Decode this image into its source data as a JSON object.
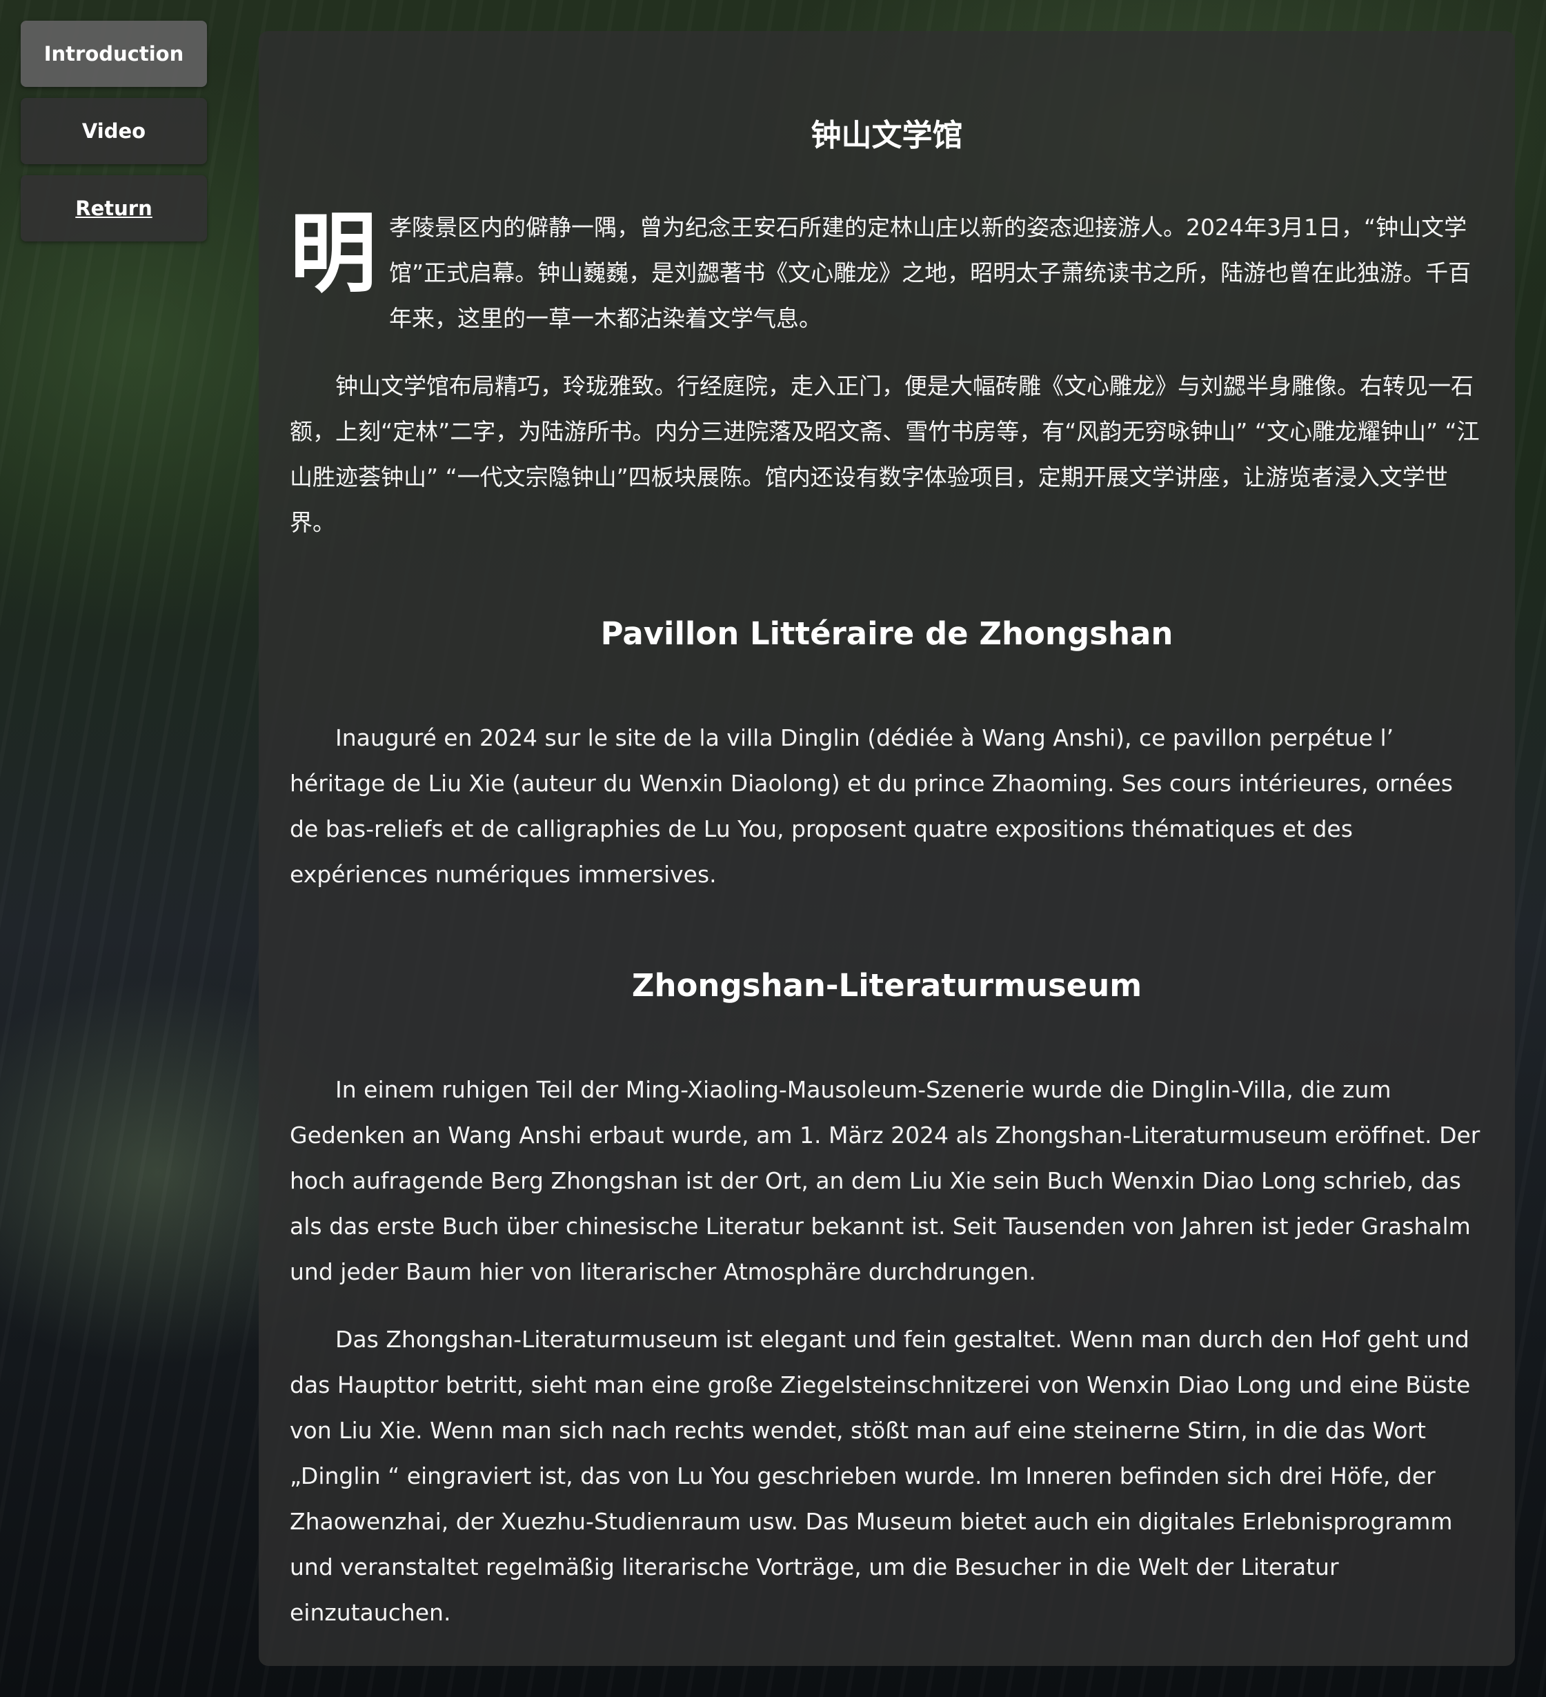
{
  "sidebar": {
    "items": [
      {
        "label": "Introduction",
        "active": true
      },
      {
        "label": "Video",
        "active": false
      },
      {
        "label": "Return",
        "active": false,
        "underlined": true
      }
    ]
  },
  "content": {
    "zh": {
      "title": "钟山文学馆",
      "dropcap": "明",
      "p1": "孝陵景区内的僻静一隅，曾为纪念王安石所建的定林山庄以新的姿态迎接游人。2024年3月1日，“钟山文学馆”正式启幕。钟山巍巍，是刘勰著书《文心雕龙》之地，昭明太子萧统读书之所，陆游也曾在此独游。千百年来，这里的一草一木都沾染着文学气息。",
      "p2": "钟山文学馆布局精巧，玲珑雅致。行经庭院，走入正门，便是大幅砖雕《文心雕龙》与刘勰半身雕像。右转见一石额，上刻“定林”二字，为陆游所书。内分三进院落及昭文斋、雪竹书房等，有“风韵无穷咏钟山” “文心雕龙耀钟山” “江山胜迹荟钟山” “一代文宗隐钟山”四板块展陈。馆内还设有数字体验项目，定期开展文学讲座，让游览者浸入文学世界。"
    },
    "fr": {
      "title": "Pavillon Littéraire de Zhongshan",
      "p1": "Inauguré en 2024 sur le site de la villa Dinglin (dédiée à Wang Anshi), ce pavillon perpétue l’ héritage de Liu Xie (auteur du Wenxin Diaolong) et du prince Zhaoming. Ses cours intérieures, ornées de bas-reliefs et de calligraphies de Lu You, proposent quatre expositions thématiques et des expériences numériques immersives."
    },
    "de": {
      "title": "Zhongshan-Literaturmuseum",
      "p1": "In einem ruhigen Teil der Ming-Xiaoling-Mausoleum-Szenerie wurde die Dinglin-Villa, die zum Gedenken an Wang Anshi erbaut wurde, am 1. März 2024 als Zhongshan-Literaturmuseum eröffnet. Der hoch aufragende Berg Zhongshan ist der Ort, an dem Liu Xie sein Buch Wenxin Diao Long schrieb, das als das erste Buch über chinesische Literatur bekannt ist. Seit Tausenden von Jahren ist jeder Grashalm und jeder Baum hier von literarischer Atmosphäre durchdrungen.",
      "p2": "Das Zhongshan-Literaturmuseum ist elegant und fein gestaltet. Wenn man durch den Hof geht und das Haupttor betritt, sieht man eine große Ziegelsteinschnitzerei von Wenxin Diao Long und eine Büste von Liu Xie. Wenn man sich nach rechts wendet, stößt man auf eine steinerne Stirn, in die das Wort „Dinglin “ eingraviert ist, das von Lu You geschrieben wurde. Im Inneren befinden sich drei Höfe, der Zhaowenzhai, der Xuezhu-Studienraum usw. Das Museum bietet auch ein digitales Erlebnisprogramm und veranstaltet regelmäßig literarische Vorträge, um die Besucher in die Welt der Literatur einzutauchen."
    }
  },
  "colors": {
    "panel_bg": "#303030",
    "button_bg": "#323232",
    "button_active_bg": "#5f5f5f",
    "text": "#ffffff"
  }
}
